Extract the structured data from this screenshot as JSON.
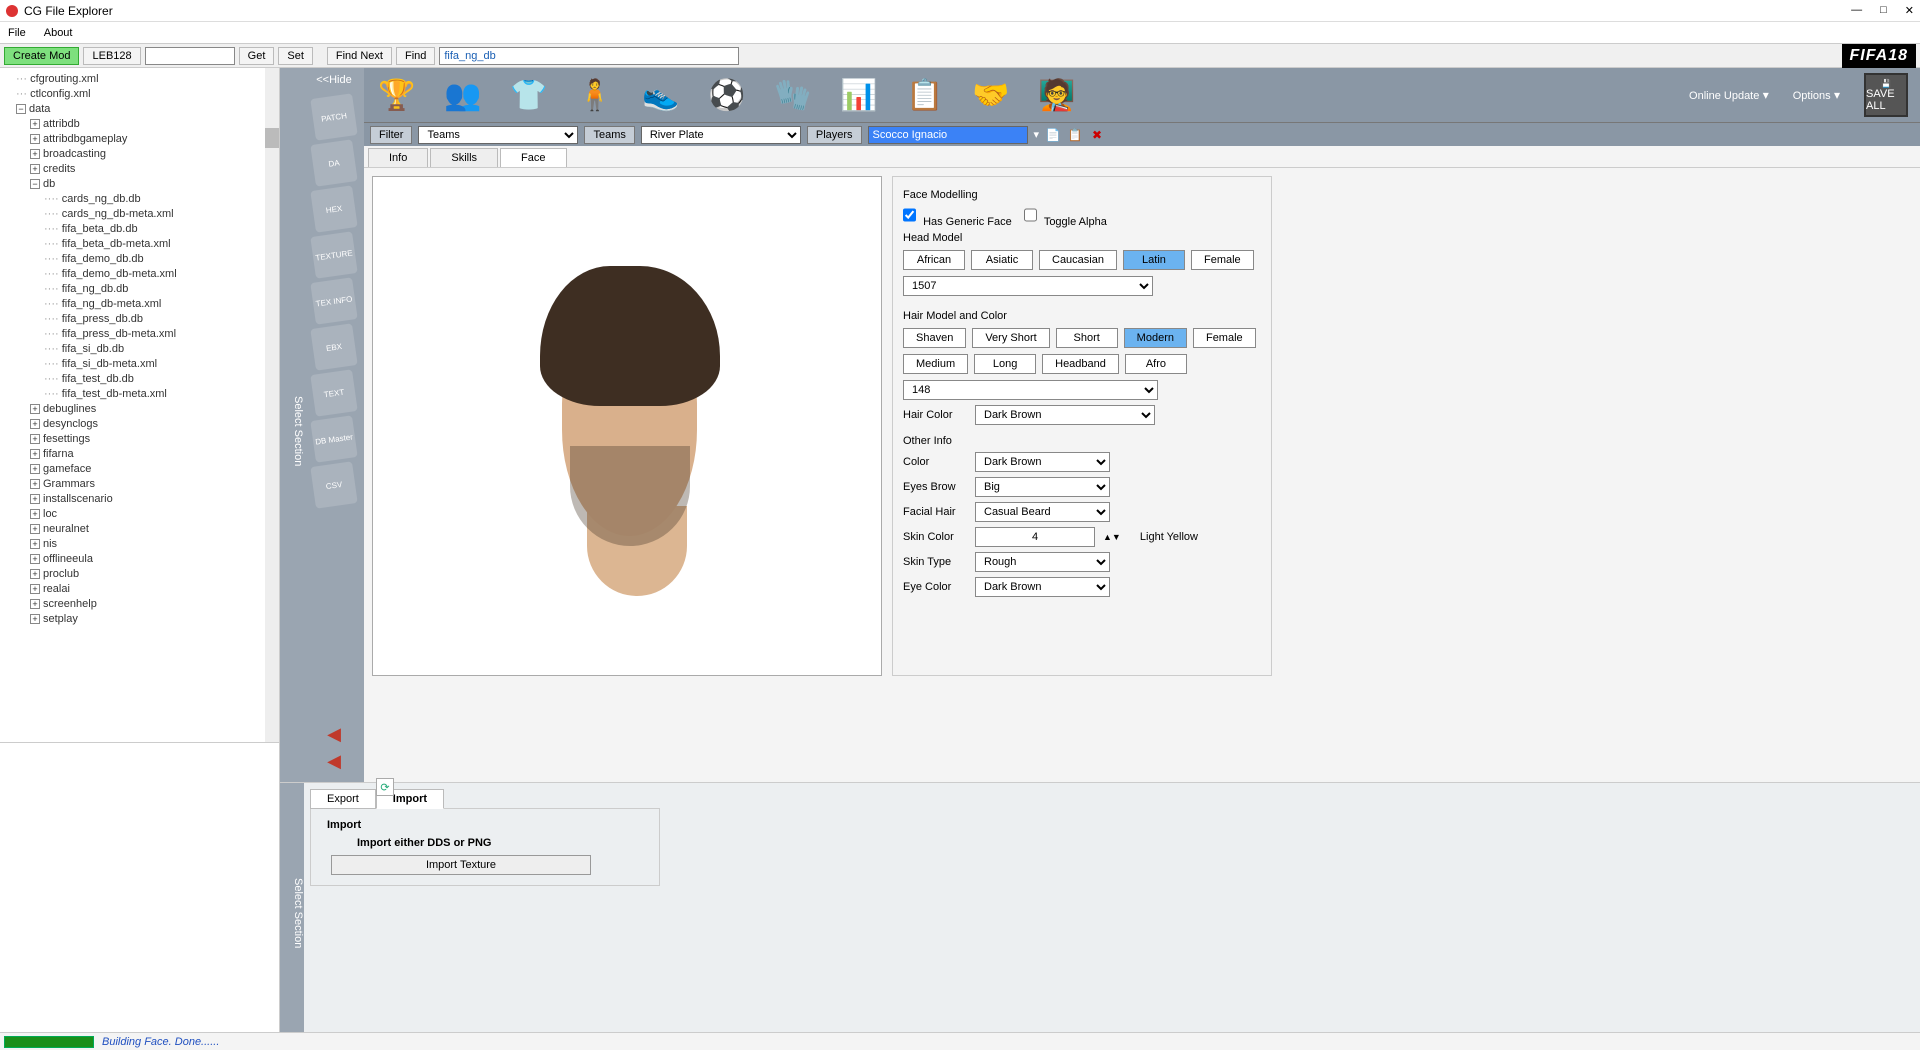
{
  "window": {
    "title": "CG File Explorer"
  },
  "menu": {
    "file": "File",
    "about": "About"
  },
  "toolbar": {
    "createmod": "Create Mod",
    "leb128": "LEB128",
    "get": "Get",
    "set": "Set",
    "findnext": "Find Next",
    "find": "Find",
    "find_value": "fifa_ng_db"
  },
  "tree": {
    "cfgrouting": "cfgrouting.xml",
    "ctlconfig": "ctlconfig.xml",
    "data": "data",
    "attribdb": "attribdb",
    "attribdbgameplay": "attribdbgameplay",
    "broadcasting": "broadcasting",
    "credits": "credits",
    "db": "db",
    "files": [
      "cards_ng_db.db",
      "cards_ng_db-meta.xml",
      "fifa_beta_db.db",
      "fifa_beta_db-meta.xml",
      "fifa_demo_db.db",
      "fifa_demo_db-meta.xml",
      "fifa_ng_db.db",
      "fifa_ng_db-meta.xml",
      "fifa_press_db.db",
      "fifa_press_db-meta.xml",
      "fifa_si_db.db",
      "fifa_si_db-meta.xml",
      "fifa_test_db.db",
      "fifa_test_db-meta.xml"
    ],
    "rest": [
      "debuglines",
      "desynclogs",
      "fesettings",
      "fifarna",
      "gameface",
      "Grammars",
      "installscenario",
      "loc",
      "neuralnet",
      "nis",
      "offlineeula",
      "proclub",
      "realai",
      "screenhelp",
      "setplay"
    ]
  },
  "sidestrip": {
    "hide": "<<Hide",
    "select": "Select Section",
    "tiles": [
      "PATCH",
      "DA",
      "HEX",
      "TEXTURE",
      "TEX INFO",
      "EBX",
      "TEXT",
      "DB Master",
      "CSV"
    ]
  },
  "iconbar": {
    "onlineupdate": "Online Update",
    "options": "Options",
    "saveall": "SAVE ALL",
    "fifa": "FIFA18"
  },
  "filter": {
    "filter_lbl": "Filter",
    "filter_val": "Teams",
    "teams_lbl": "Teams",
    "teams_val": "River Plate",
    "players_lbl": "Players",
    "players_val": "Scocco Ignacio"
  },
  "tabs": {
    "info": "Info",
    "skills": "Skills",
    "face": "Face"
  },
  "face": {
    "title": "Face Modelling",
    "has_generic": "Has Generic Face",
    "toggle_alpha": "Toggle Alpha",
    "head_model": "Head Model",
    "hm_btns": [
      "African",
      "Asiatic",
      "Caucasian",
      "Latin",
      "Female"
    ],
    "hm_sel": "Latin",
    "hm_value": "1507",
    "hair_title": "Hair Model and Color",
    "hair_btns": [
      "Shaven",
      "Very Short",
      "Short",
      "Modern",
      "Female",
      "Medium",
      "Long",
      "Headband",
      "Afro"
    ],
    "hair_sel": "Modern",
    "hair_value": "148",
    "hair_color_lbl": "Hair Color",
    "hair_color": "Dark Brown",
    "other_info": "Other Info",
    "color_lbl": "Color",
    "color": "Dark Brown",
    "eyesbrow_lbl": "Eyes Brow",
    "eyesbrow": "Big",
    "facialhair_lbl": "Facial Hair",
    "facialhair": "Casual Beard",
    "skincolor_lbl": "Skin Color",
    "skincolor": "4",
    "skincolor_name": "Light Yellow",
    "skintype_lbl": "Skin Type",
    "skintype": "Rough",
    "eyecolor_lbl": "Eye Color",
    "eyecolor": "Dark Brown"
  },
  "bottom": {
    "export": "Export",
    "import": "Import",
    "import_title": "Import",
    "import_hint": "Import either DDS or PNG",
    "import_btn": "Import Texture",
    "select": "Select Section"
  },
  "status": {
    "msg": "Building Face. Done......"
  }
}
